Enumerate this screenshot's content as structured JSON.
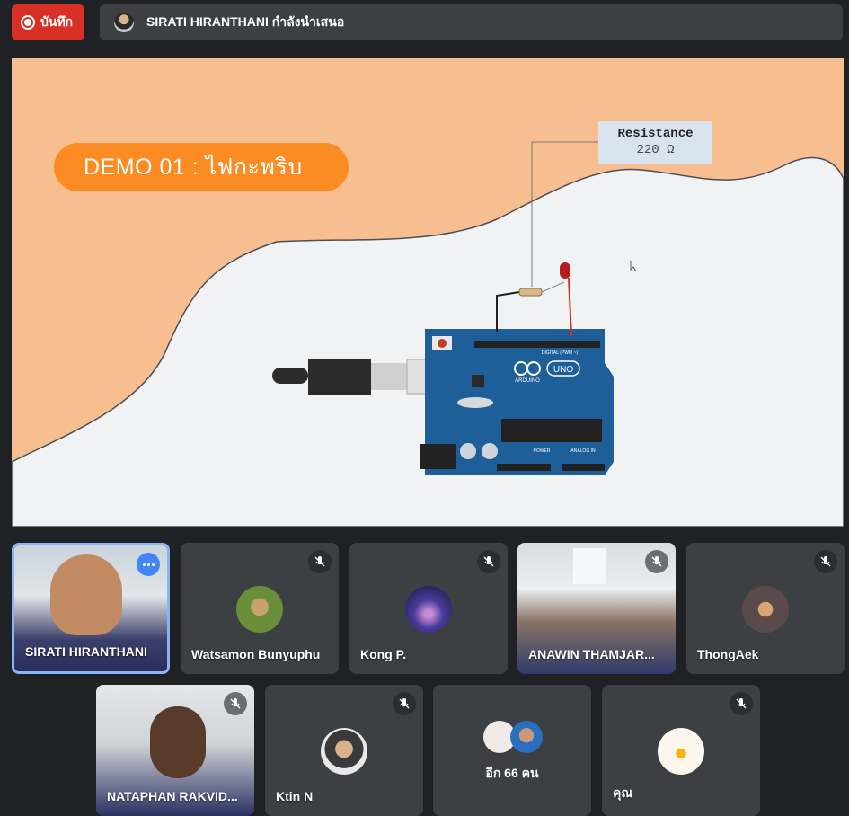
{
  "top_bar": {
    "record_label": "บันทึก",
    "presenting_text": "SIRATI HIRANTHANI กำลังนำเสนอ"
  },
  "share": {
    "demo_title": "DEMO 01 : ไฟกะพริบ",
    "resistance_label": "Resistance",
    "resistance_value": "220 Ω",
    "board_brand": "UNO",
    "board_name": "ARDUINO",
    "digital_label": "DIGITAL (PWM ~)",
    "power_label": "POWER",
    "analog_label": "ANALOG IN"
  },
  "participants": {
    "row1": [
      {
        "name": "SIRATI HIRANTHANI"
      },
      {
        "name": "Watsamon Bunyuphu"
      },
      {
        "name": "Kong P."
      },
      {
        "name": "ANAWIN THAMJAR..."
      },
      {
        "name": "ThongAek"
      }
    ],
    "row2": [
      {
        "name": "NATAPHAN RAKVID..."
      },
      {
        "name": "Ktin N"
      },
      {
        "name": "อีก 66 คน"
      },
      {
        "name": "คุณ"
      }
    ]
  },
  "colors": {
    "record": "#d93025",
    "accent_blue": "#4285f4",
    "demo_orange": "#fb8c23",
    "slide_peach": "#f7bf8f"
  },
  "icons": [
    "record-icon",
    "mic-off-icon",
    "more-options-icon"
  ]
}
